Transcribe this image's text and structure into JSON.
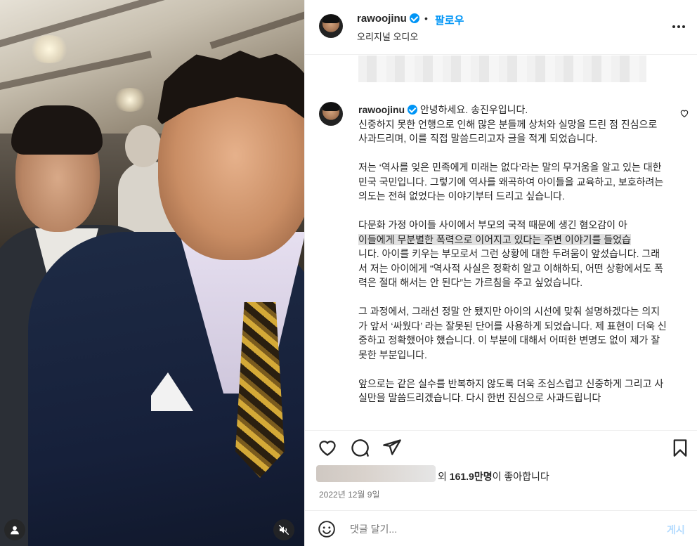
{
  "post": {
    "username": "rawoojinu",
    "follow_label": "팔로우",
    "separator": "•",
    "audio_label": "오리지널 오디오"
  },
  "caption": {
    "username": "rawoojinu",
    "lines": [
      "안녕하세요. 송진우입니다.",
      "신중하지 못한 언행으로 인해 많은 분들께 상처와 실망을 드린 점 진심으로 사과드리며, 이를 직접 말씀드리고자 글을 적게 되었습니다.",
      "",
      "저는 ‘역사를 잊은 민족에게 미래는 없다’라는 말의 무거움을 알고 있는 대한민국 국민입니다. 그렇기에 역사를 왜곡하여 아이들을 교육하고, 보호하려는 의도는 전혀 없었다는 이야기부터 드리고 싶습니다.",
      "",
      "다문화 가정 아이들 사이에서 부모의 국적 때문에 생긴 혐오감이 아",
      "이들에게 무분별한 폭력으로 이어지고 있다는 주변 이야기를 들었습",
      "니다. 아이를 키우는 부모로서 그런 상황에 대한 두려움이 앞섰습니다. 그래서 저는 아이에게 “역사적 사실은 정확히 알고 이해하되, 어떤 상황에서도 폭력은 절대 해서는 안 된다”는 가르침을 주고 싶었습니다.",
      "",
      "그 과정에서, 그래선 정말 안 됐지만 아이의 시선에 맞춰 설명하겠다는 의지가 앞서 ‘싸웠다’ 라는 잘못된 단어를 사용하게 되었습니다. 제 표현이 더욱 신중하고 정확했어야 했습니다. 이 부분에 대해서 어떠한 변명도 없이 제가 잘못한 부분입니다.",
      "",
      "앞으로는 같은 실수를 반복하지 않도록 더욱 조심스럽고 신중하게 그리고 사실만을 말씀드리겠습니다. 다시 한번 진심으로 사과드립니다"
    ]
  },
  "likes": {
    "suffix_prefix": "외 ",
    "count": "161.9만명",
    "suffix": "이 좋아합니다"
  },
  "date": "2022년 12월 9일",
  "comment": {
    "placeholder": "댓글 달기...",
    "post_label": "게시"
  },
  "icons": {
    "more": "more-horizontal-icon",
    "like": "heart-icon",
    "comment": "comment-icon",
    "share": "send-icon",
    "save": "bookmark-icon",
    "emoji": "smiley-icon",
    "mute": "muted-speaker-icon",
    "tags": "user-tag-icon"
  },
  "colors": {
    "accent": "#0095f6",
    "post_disabled": "#b3dbff",
    "secondary_text": "#737373"
  }
}
